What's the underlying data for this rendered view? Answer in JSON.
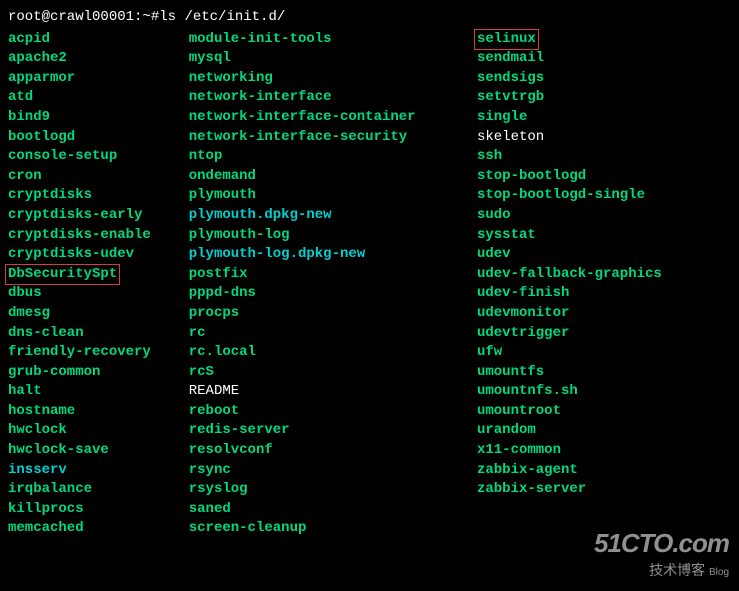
{
  "prompt": "root@crawl00001:~# ",
  "command": "ls /etc/init.d/",
  "columns": [
    [
      {
        "name": "acpid",
        "class": "green"
      },
      {
        "name": "apache2",
        "class": "green"
      },
      {
        "name": "apparmor",
        "class": "green"
      },
      {
        "name": "atd",
        "class": "green"
      },
      {
        "name": "bind9",
        "class": "green"
      },
      {
        "name": "bootlogd",
        "class": "green"
      },
      {
        "name": "console-setup",
        "class": "green"
      },
      {
        "name": "cron",
        "class": "green"
      },
      {
        "name": "cryptdisks",
        "class": "green"
      },
      {
        "name": "cryptdisks-early",
        "class": "green"
      },
      {
        "name": "cryptdisks-enable",
        "class": "green"
      },
      {
        "name": "cryptdisks-udev",
        "class": "green"
      },
      {
        "name": "DbSecuritySpt",
        "class": "green",
        "highlighted": true
      },
      {
        "name": "dbus",
        "class": "green"
      },
      {
        "name": "dmesg",
        "class": "green"
      },
      {
        "name": "dns-clean",
        "class": "green"
      },
      {
        "name": "friendly-recovery",
        "class": "green"
      },
      {
        "name": "grub-common",
        "class": "green"
      },
      {
        "name": "halt",
        "class": "green"
      },
      {
        "name": "hostname",
        "class": "green"
      },
      {
        "name": "hwclock",
        "class": "green"
      },
      {
        "name": "hwclock-save",
        "class": "green"
      },
      {
        "name": "insserv",
        "class": "cyan"
      },
      {
        "name": "irqbalance",
        "class": "green"
      },
      {
        "name": "killprocs",
        "class": "green"
      },
      {
        "name": "memcached",
        "class": "green"
      }
    ],
    [
      {
        "name": "module-init-tools",
        "class": "green"
      },
      {
        "name": "mysql",
        "class": "green"
      },
      {
        "name": "networking",
        "class": "green"
      },
      {
        "name": "network-interface",
        "class": "green"
      },
      {
        "name": "network-interface-container",
        "class": "green"
      },
      {
        "name": "network-interface-security",
        "class": "green"
      },
      {
        "name": "ntop",
        "class": "green"
      },
      {
        "name": "ondemand",
        "class": "green"
      },
      {
        "name": "plymouth",
        "class": "green"
      },
      {
        "name": "plymouth.dpkg-new",
        "class": "cyan"
      },
      {
        "name": "plymouth-log",
        "class": "green"
      },
      {
        "name": "plymouth-log.dpkg-new",
        "class": "cyan"
      },
      {
        "name": "postfix",
        "class": "green"
      },
      {
        "name": "pppd-dns",
        "class": "green"
      },
      {
        "name": "procps",
        "class": "green"
      },
      {
        "name": "rc",
        "class": "green"
      },
      {
        "name": "rc.local",
        "class": "green"
      },
      {
        "name": "rcS",
        "class": "green"
      },
      {
        "name": "README",
        "class": "white"
      },
      {
        "name": "reboot",
        "class": "green"
      },
      {
        "name": "redis-server",
        "class": "green"
      },
      {
        "name": "resolvconf",
        "class": "green"
      },
      {
        "name": "rsync",
        "class": "green"
      },
      {
        "name": "rsyslog",
        "class": "green"
      },
      {
        "name": "saned",
        "class": "green"
      },
      {
        "name": "screen-cleanup",
        "class": "green"
      }
    ],
    [
      {
        "name": "selinux",
        "class": "green",
        "highlighted": true
      },
      {
        "name": "sendmail",
        "class": "green"
      },
      {
        "name": "sendsigs",
        "class": "green"
      },
      {
        "name": "setvtrgb",
        "class": "green"
      },
      {
        "name": "single",
        "class": "green"
      },
      {
        "name": "skeleton",
        "class": "white"
      },
      {
        "name": "ssh",
        "class": "green"
      },
      {
        "name": "stop-bootlogd",
        "class": "green"
      },
      {
        "name": "stop-bootlogd-single",
        "class": "green"
      },
      {
        "name": "sudo",
        "class": "green"
      },
      {
        "name": "sysstat",
        "class": "green"
      },
      {
        "name": "udev",
        "class": "green"
      },
      {
        "name": "udev-fallback-graphics",
        "class": "green"
      },
      {
        "name": "udev-finish",
        "class": "green"
      },
      {
        "name": "udevmonitor",
        "class": "green"
      },
      {
        "name": "udevtrigger",
        "class": "green"
      },
      {
        "name": "ufw",
        "class": "green"
      },
      {
        "name": "umountfs",
        "class": "green"
      },
      {
        "name": "umountnfs.sh",
        "class": "green"
      },
      {
        "name": "umountroot",
        "class": "green"
      },
      {
        "name": "urandom",
        "class": "green"
      },
      {
        "name": "x11-common",
        "class": "green"
      },
      {
        "name": "zabbix-agent",
        "class": "green"
      },
      {
        "name": "zabbix-server",
        "class": "green"
      }
    ]
  ],
  "watermark": {
    "big": "51CTO.com",
    "small": "技术博客",
    "blog": "Blog"
  }
}
